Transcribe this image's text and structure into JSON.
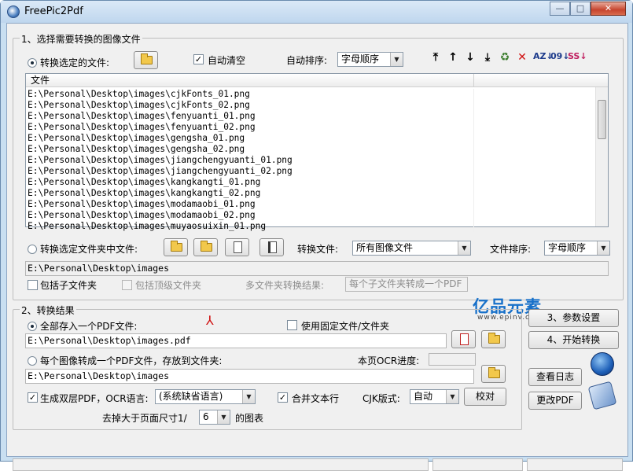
{
  "window": {
    "title": "FreePic2Pdf",
    "minimize": "—",
    "maximize": "□",
    "close": "✕"
  },
  "group1": {
    "legend": "1、选择需要转换的图像文件",
    "radio_files_label": "转换选定的文件:",
    "auto_clear_label": "自动清空",
    "auto_sort_label": "自动排序:",
    "auto_sort_value": "字母顺序",
    "list_header": "文件",
    "files": [
      "E:\\Personal\\Desktop\\images\\cjkFonts_01.png",
      "E:\\Personal\\Desktop\\images\\cjkFonts_02.png",
      "E:\\Personal\\Desktop\\images\\fenyuanti_01.png",
      "E:\\Personal\\Desktop\\images\\fenyuanti_02.png",
      "E:\\Personal\\Desktop\\images\\gengsha_01.png",
      "E:\\Personal\\Desktop\\images\\gengsha_02.png",
      "E:\\Personal\\Desktop\\images\\jiangchengyuanti_01.png",
      "E:\\Personal\\Desktop\\images\\jiangchengyuanti_02.png",
      "E:\\Personal\\Desktop\\images\\kangkangti_01.png",
      "E:\\Personal\\Desktop\\images\\kangkangti_02.png",
      "E:\\Personal\\Desktop\\images\\modamaobi_01.png",
      "E:\\Personal\\Desktop\\images\\modamaobi_02.png",
      "E:\\Personal\\Desktop\\images\\muyaosuixin_01.png"
    ],
    "radio_folder_label": "转换选定文件夹中文件:",
    "convert_files_label": "转换文件:",
    "convert_files_value": "所有图像文件",
    "file_sort_label": "文件排序:",
    "file_sort_value": "字母顺序",
    "folder_path": "E:\\Personal\\Desktop\\images",
    "include_sub_label": "包括子文件夹",
    "include_top_label": "包括顶级文件夹",
    "multi_result_label": "多文件夹转换结果:",
    "multi_result_value": "每个子文件夹转成一个PDF"
  },
  "group2": {
    "legend": "2、转换结果",
    "radio_single_label": "全部存入一个PDF文件:",
    "fixed_file_label": "使用固定文件/文件夹",
    "pdf_path": "E:\\Personal\\Desktop\\images.pdf",
    "radio_each_label": "每个图像转成一个PDF文件，存放到文件夹:",
    "ocr_progress_label": "本页OCR进度:",
    "folder_path": "E:\\Personal\\Desktop\\images",
    "dual_layer_label": "生成双层PDF，OCR语言:",
    "ocr_lang_value": "(系统缺省语言)",
    "merge_lines_label": "合并文本行",
    "cjk_label": "CJK版式:",
    "cjk_value": "自动",
    "proofread_button": "校对",
    "remove_pre": "去掉大于页面尺寸1/",
    "remove_value": "6",
    "remove_post": "的图表"
  },
  "buttons": {
    "settings": "3、参数设置",
    "start": "4、开始转换",
    "view_log": "查看日志",
    "change_pdf": "更改PDF"
  },
  "logo": {
    "text": "亿品元素",
    "sub": "www.epinv.com"
  }
}
